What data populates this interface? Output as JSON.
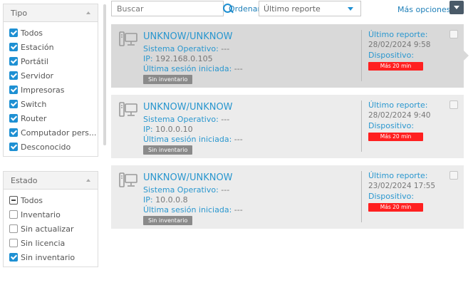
{
  "filters": {
    "tipo": {
      "title": "Tipo",
      "options": [
        {
          "label": "Todos",
          "checked": true
        },
        {
          "label": "Estación",
          "checked": true
        },
        {
          "label": "Portátil",
          "checked": true
        },
        {
          "label": "Servidor",
          "checked": true
        },
        {
          "label": "Impresoras",
          "checked": true
        },
        {
          "label": "Switch",
          "checked": true
        },
        {
          "label": "Router",
          "checked": true
        },
        {
          "label": "Computador pers...",
          "checked": true
        },
        {
          "label": "Desconocido",
          "checked": true
        }
      ]
    },
    "estado": {
      "title": "Estado",
      "options": [
        {
          "label": "Todos",
          "state": "partial"
        },
        {
          "label": "Inventario",
          "state": "unchecked"
        },
        {
          "label": "Sin actualizar",
          "state": "unchecked"
        },
        {
          "label": "Sin licencia",
          "state": "unchecked"
        },
        {
          "label": "Sin inventario",
          "state": "checked"
        }
      ]
    }
  },
  "toolbar": {
    "search_placeholder": "Buscar",
    "order_label": "Ordenar:",
    "order_value": "Último reporte",
    "more_label": "Más opciones:"
  },
  "labels": {
    "os": "Sistema Operativo:",
    "ip": "IP:",
    "session": "Última sesión iniciada:",
    "report": "Último reporte:",
    "device": "Dispositivo:"
  },
  "devices": [
    {
      "name": "UNKNOW/UNKNOW",
      "os": "---",
      "ip": "192.168.0.105",
      "session": "---",
      "tag": "Sin inventario",
      "report_date": "28/02/2024 9:58",
      "alert": "Más 20 min",
      "selected": true
    },
    {
      "name": "UNKNOW/UNKNOW",
      "os": "---",
      "ip": "10.0.0.10",
      "session": "---",
      "tag": "Sin inventario",
      "report_date": "28/02/2024 9:40",
      "alert": "Más 20 min",
      "selected": false
    },
    {
      "name": "UNKNOW/UNKNOW",
      "os": "---",
      "ip": "10.0.0.8",
      "session": "---",
      "tag": "Sin inventario",
      "report_date": "23/02/2024 17:55",
      "alert": "Más 20 min",
      "selected": false
    }
  ],
  "colors": {
    "accent": "#2a97cf",
    "alert": "#ff2020",
    "tag": "#8a8a8a"
  },
  "icons": {
    "device": "desktop-computer-icon",
    "search": "search-icon",
    "order": "caret-down-icon"
  }
}
